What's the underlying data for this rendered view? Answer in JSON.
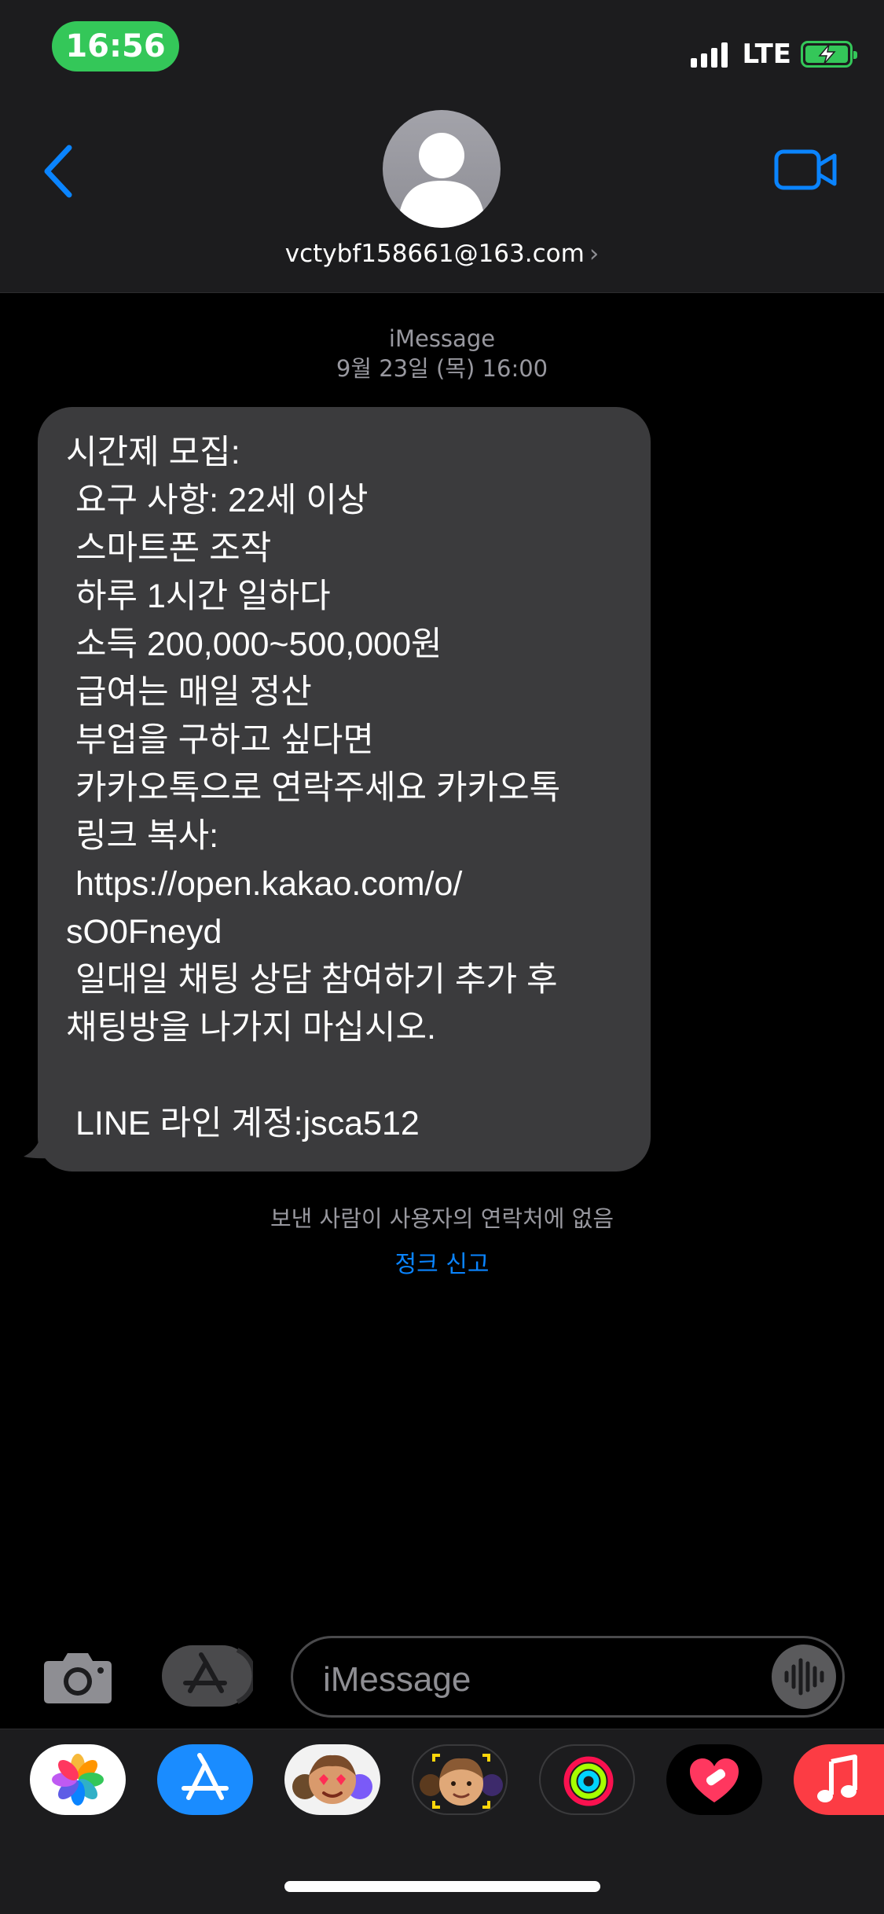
{
  "status": {
    "time": "16:56",
    "network": "LTE"
  },
  "header": {
    "contact": "vctybf158661@163.com",
    "chevron": "›"
  },
  "meta": {
    "service": "iMessage",
    "date": "9월 23일 (목) 16:00"
  },
  "message": {
    "lines": [
      "시간제 모집:",
      " 요구 사항: 22세 이상",
      " 스마트폰 조작",
      " 하루 1시간 일하다",
      " 소득 200,000~500,000원",
      " 급여는 매일 정산",
      " 부업을 구하고 싶다면",
      " 카카오톡으로 연락주세요 카카오톡",
      " 링크 복사:",
      " https://open.kakao.com/o/",
      "sO0Fneyd",
      " 일대일 채팅 상담 참여하기 추가 후",
      "채팅방을 나가지 마십시오.",
      " ",
      " LINE 라인 계정:jsca512"
    ]
  },
  "notice": {
    "text": "보낸 사람이 사용자의 연락처에 없음",
    "report": "정크 신고"
  },
  "input": {
    "placeholder": "iMessage"
  },
  "apps": [
    "photos-icon",
    "app-store-icon",
    "memoji-stickers-icon",
    "memoji-icon",
    "activity-icon",
    "heart-app-icon",
    "music-icon"
  ],
  "colors": {
    "accent": "#0a84ff",
    "bubble": "#3b3b3d",
    "green": "#34c759",
    "header": "#1c1c1e"
  }
}
